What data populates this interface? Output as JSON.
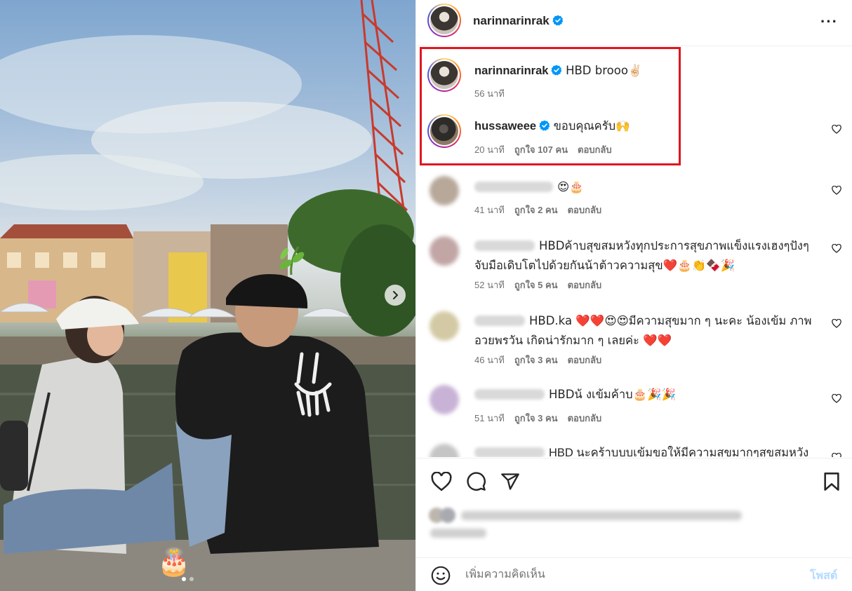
{
  "post": {
    "author": "narinnarinrak",
    "carousel": {
      "current": 1,
      "total": 2
    },
    "overlay_emoji": "🎂"
  },
  "comments": [
    {
      "user": "narinnarinrak",
      "verified": true,
      "text": "HBD brooo✌🏻",
      "time": "56 นาที",
      "likes": "",
      "reply": ""
    },
    {
      "user": "hussaweee",
      "verified": true,
      "text": "ขอบคุณครับ🙌",
      "time": "20 นาที",
      "likes": "ถูกใจ 107 คน",
      "reply": "ตอบกลับ"
    },
    {
      "user": "",
      "verified": false,
      "text": "😍🎂",
      "time": "41 นาที",
      "likes": "ถูกใจ 2 คน",
      "reply": "ตอบกลับ"
    },
    {
      "user": "",
      "verified": false,
      "text": "HBDค้าบสุขสมหวังทุกประการสุขภาพแข็งแรงเฮงๆปังๆ จับมือเดิบโตไปด้วยกันน้าต้าวความสุข❤️🎂👏🍫🎉",
      "time": "52 นาที",
      "likes": "ถูกใจ 5 คน",
      "reply": "ตอบกลับ"
    },
    {
      "user": "",
      "verified": false,
      "text": "HBD.ka ❤️❤️😍😍มีความสุขมาก ๆ นะคะ น้องเข้ม ภาพอวยพรวัน เกิดน่ารักมาก ๆ เลยค่ะ ❤️❤️",
      "time": "46 นาที",
      "likes": "ถูกใจ 3 คน",
      "reply": "ตอบกลับ"
    },
    {
      "user": "",
      "verified": false,
      "text": "HBDน้ งเข้มค้าบ🎂🎉🎉",
      "time": "51 นาที",
      "likes": "ถูกใจ 3 คน",
      "reply": "ตอบกลับ"
    },
    {
      "user": "",
      "verified": false,
      "text": "HBD นะคร้าบบบเข้มขอให้มีความสุขมากๆสุขสมหวัง",
      "time": "",
      "likes": "",
      "reply": ""
    }
  ],
  "add_comment": {
    "placeholder": "เพิ่มความคิดเห็น",
    "post_label": "โพสต์"
  },
  "colors": {
    "highlight_box": "#e0161e",
    "verified": "#0095f6",
    "post_button_disabled": "#b3dbff"
  },
  "icons": [
    "heart-icon",
    "comment-icon",
    "share-icon",
    "bookmark-icon",
    "emoji-icon",
    "more-icon",
    "chevron-right-icon",
    "verified-badge-icon"
  ]
}
